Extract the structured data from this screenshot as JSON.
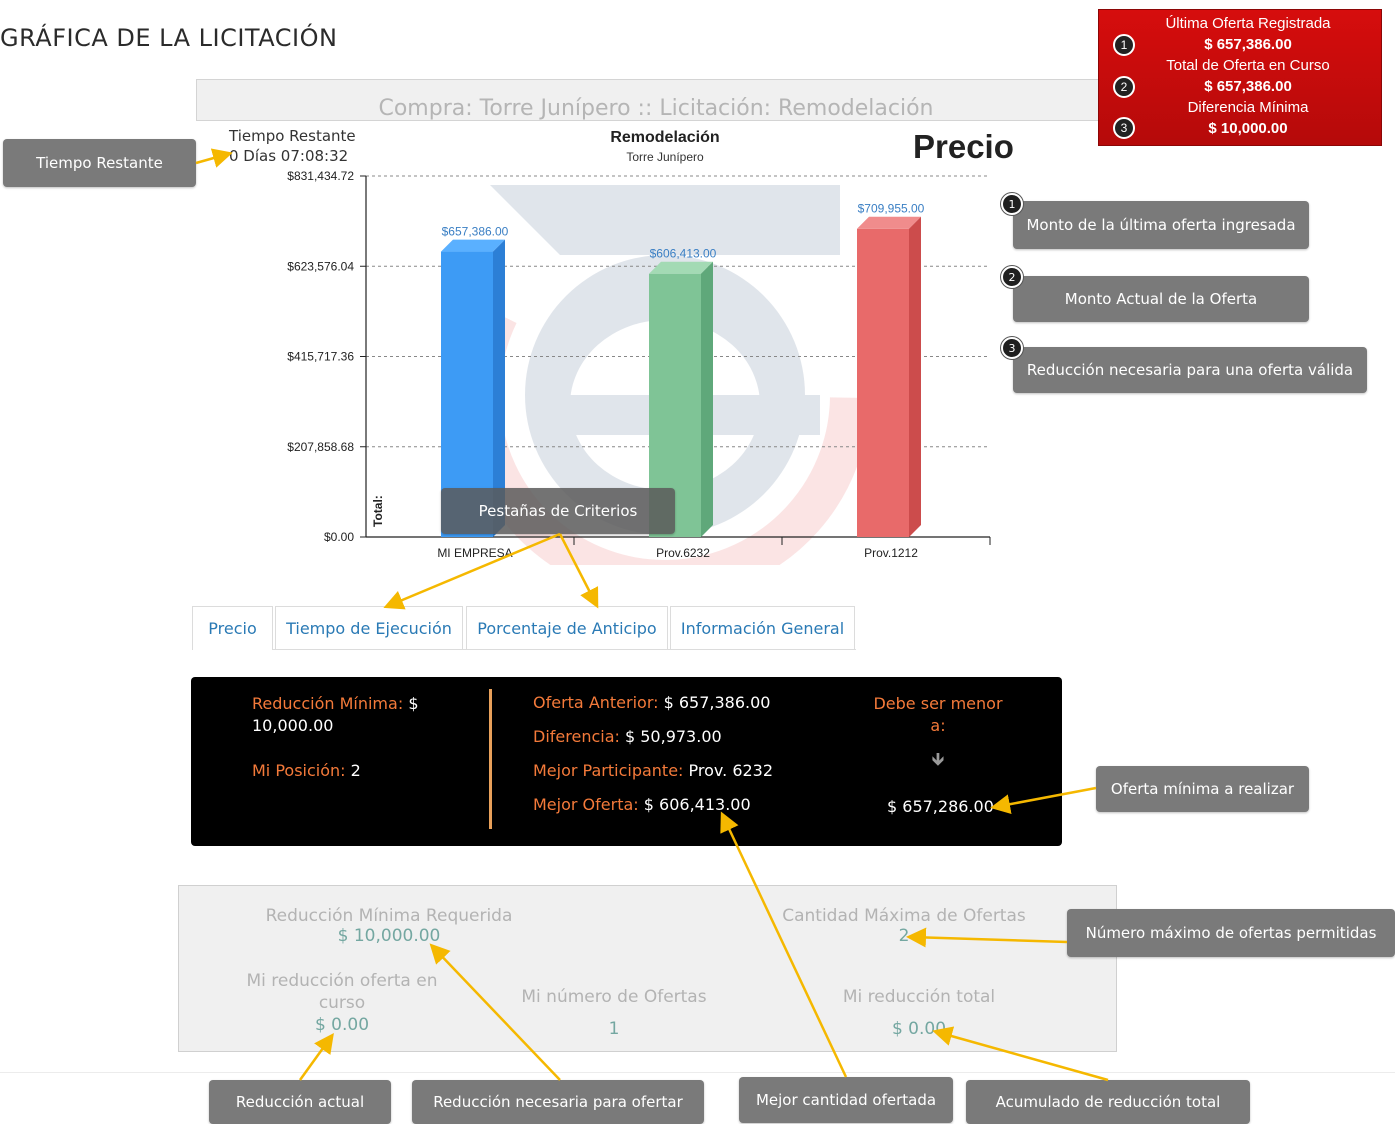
{
  "page_title": "GRÁFICA DE LA LICITACIÓN",
  "header": {
    "text": "Compra: Torre Junípero :: Licitación: Remodelación"
  },
  "red_panel": {
    "items": [
      {
        "num": "1",
        "label": "Última Oferta Registrada",
        "value": "$ 657,386.00"
      },
      {
        "num": "2",
        "label": "Total de Oferta en Curso",
        "value": "$ 657,386.00"
      },
      {
        "num": "3",
        "label": "Diferencia Mínima",
        "value": "$ 10,000.00"
      }
    ]
  },
  "timer": {
    "label": "Tiempo Restante",
    "value": "0 Días 07:08:32"
  },
  "chart_heading": "Precio",
  "chart_data": {
    "type": "bar",
    "title": "Remodelación",
    "subtitle": "Torre Junípero",
    "ylabel": "Total:",
    "categories": [
      "MI EMPRESA",
      "Prov.6232",
      "Prov.1212"
    ],
    "values": [
      657386.0,
      606413.0,
      709955.0
    ],
    "value_labels": [
      "$657,386.00",
      "$606,413.00",
      "$709,955.00"
    ],
    "colors": [
      "#3d9bf5",
      "#7fc496",
      "#e86a6a"
    ],
    "yticks": [
      "$0.00",
      "$207,858.68",
      "$415,717.36",
      "$623,576.04",
      "$831,434.72"
    ],
    "ytick_values": [
      0,
      207858.68,
      415717.36,
      623576.04,
      831434.72
    ],
    "ylim": [
      0,
      831434.72
    ],
    "grid": true
  },
  "tabs": [
    "Precio",
    "Tiempo de Ejecución",
    "Porcentaje de Anticipo",
    "Información General"
  ],
  "black_panel": {
    "reduccion_minima_label": "Reducción Mínima:",
    "reduccion_minima_value": "$ 10,000.00",
    "mi_posicion_label": "Mi Posición:",
    "mi_posicion_value": "2",
    "oferta_anterior_label": "Oferta Anterior:",
    "oferta_anterior_value": "$ 657,386.00",
    "diferencia_label": "Diferencia:",
    "diferencia_value": "$ 50,973.00",
    "mejor_participante_label": "Mejor Participante:",
    "mejor_participante_value": "Prov. 6232",
    "mejor_oferta_label": "Mejor Oferta:",
    "mejor_oferta_value": "$ 606,413.00",
    "debe_ser_menor": "Debe ser menor a:",
    "arrow": "🡻",
    "oferta_minima_value": "$ 657,286.00"
  },
  "gray_panel": {
    "reduccion_requerida_label": "Reducción Mínima Requerida",
    "reduccion_requerida_value": "$ 10,000.00",
    "cantidad_maxima_label": "Cantidad Máxima de Ofertas",
    "cantidad_maxima_value": "2",
    "mi_reduccion_curso_label": "Mi reducción oferta en curso",
    "mi_reduccion_curso_value": "$ 0.00",
    "mi_numero_label": "Mi número de Ofertas",
    "mi_numero_value": "1",
    "mi_reduccion_total_label": "Mi reducción total",
    "mi_reduccion_total_value": "$ 0.00"
  },
  "callouts": {
    "tiempo_restante": "Tiempo Restante",
    "monto_ultima": "Monto de la última oferta ingresada",
    "monto_actual": "Monto Actual de la Oferta",
    "reduccion_valida": "Reducción necesaria para una oferta válida",
    "pestanas": "Pestañas de Criterios",
    "oferta_minima": "Oferta mínima a realizar",
    "numero_maximo": "Número máximo de ofertas permitidas",
    "reduccion_actual": "Reducción actual",
    "reduccion_ofertar": "Reducción necesaria para ofertar",
    "mejor_cantidad": "Mejor cantidad ofertada",
    "acumulado": "Acumulado de reducción total"
  },
  "callout_badges": [
    "1",
    "2",
    "3"
  ],
  "colors": {
    "accent_orange": "#f47a3a",
    "tab_blue": "#2a7ab5",
    "panel_red": "#c80c0c",
    "arrow_yellow": "#f5b800"
  }
}
